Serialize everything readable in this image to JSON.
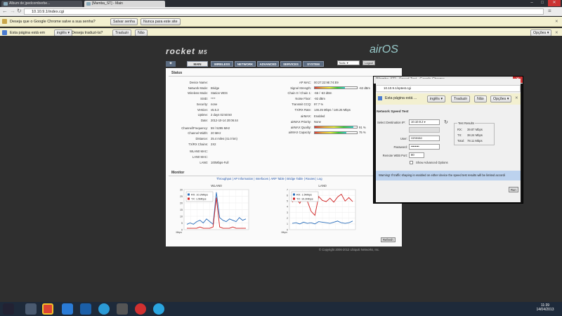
{
  "tabs": [
    {
      "label": "Album de jpedcomberbe..."
    },
    {
      "label": "[Mamba_ST] - Main"
    }
  ],
  "window_controls": {
    "min": "–",
    "max": "□",
    "close": "✕"
  },
  "address": {
    "url": "10.10.9.1/index.cgi"
  },
  "password_bar": {
    "text": "Deseja que o Google Chrome salve a sua senha?",
    "save": "Salvar senha",
    "never": "Nunca para este site"
  },
  "translate_bar": {
    "text1": "Esta página está em",
    "language": "inglês",
    "text2": "Deseja traduzi-la?",
    "translate": "Traduzir",
    "no": "Não",
    "options": "Opções"
  },
  "brand": {
    "product": "rocket",
    "model": "M5",
    "os": "airOS",
    "tools": "Tools:",
    "logout": "Logout"
  },
  "nav": [
    "MAIN",
    "WIRELESS",
    "NETWORK",
    "ADVANCED",
    "SERVICES",
    "SYSTEM"
  ],
  "status": {
    "title": "Status",
    "left": [
      {
        "label": "Device Name:",
        "value": ""
      },
      {
        "label": "Network Mode:",
        "value": "Bridge"
      },
      {
        "label": "Wireless Mode:",
        "value": "Station WDS"
      },
      {
        "label": "SSID:",
        "value": "****"
      },
      {
        "label": "Security:",
        "value": "none"
      },
      {
        "label": "Version:",
        "value": "v5.5.3"
      },
      {
        "label": "Uptime:",
        "value": "2 days 02:50:50"
      },
      {
        "label": "Date:",
        "value": "2012-10-14 20:06:44"
      },
      {
        "label": "Channel/Frequency:",
        "value": "59 / 5295 MHz"
      },
      {
        "label": "Channel Width:",
        "value": "20 MHz"
      },
      {
        "label": "Distance:",
        "value": "25.4 miles (41.0 km)"
      },
      {
        "label": "TX/RX Chains:",
        "value": "2X2"
      },
      {
        "label": "WLAN0 MAC:",
        "value": ""
      },
      {
        "label": "LAN0 MAC:",
        "value": ""
      },
      {
        "label": "LAN0:",
        "value": "100Mbps-Full"
      }
    ],
    "right": [
      {
        "label": "AP MAC:",
        "value": "00:27:22:9E:74:E9"
      },
      {
        "label": "Signal Strength:",
        "value": "-62 dBm",
        "bar": 0.72
      },
      {
        "label": "Chain 0 / Chain 1:",
        "value": "-66 / -63 dBm"
      },
      {
        "label": "Noise Floor:",
        "value": "-92 dBm"
      },
      {
        "label": "Transmit CCQ:",
        "value": "97.7 %"
      },
      {
        "label": "TX/RX Rate:",
        "value": "146.25 Mbps / 146.25 Mbps"
      },
      {
        "label": "airMAX:",
        "value": "Enabled"
      },
      {
        "label": "airMAX Priority:",
        "value": "None"
      },
      {
        "label": "airMAX Quality:",
        "value": "91 %",
        "bar": 0.91
      },
      {
        "label": "airMAX Capacity:",
        "value": "75 %",
        "bar": 0.75
      }
    ]
  },
  "monitor": {
    "title": "Monitor",
    "links": "Throughput | AP Information | Interfaces | ARP Table | Bridge Table | Routes | Log",
    "refresh": "Refresh",
    "charts": [
      {
        "title": "WLAN0",
        "unit": "Mbps",
        "yticks": [
          "30",
          "25",
          "20",
          "15",
          "10",
          "5",
          "0"
        ],
        "rx_label": "RX: 10.2Mbps",
        "tx_label": "TX: 1.5Mbps",
        "rx": [
          4,
          5,
          4,
          6,
          7,
          5,
          8,
          6,
          4,
          28,
          9,
          7,
          6,
          8,
          7,
          6,
          9,
          7,
          8
        ],
        "tx": [
          1,
          1,
          1,
          1,
          2,
          1,
          1,
          1,
          2,
          24,
          2,
          1,
          1,
          1,
          2,
          1,
          1,
          1,
          1
        ],
        "ymax": 30
      },
      {
        "title": "LAN0",
        "unit": "Mbps",
        "yticks": [
          "7",
          "6",
          "5",
          "4",
          "3",
          "2",
          "1",
          "0"
        ],
        "rx_label": "RX: 1.5Mbps",
        "tx_label": "TX: 10.2Mbps",
        "rx": [
          1.1,
          1.2,
          1.0,
          1.3,
          1.1,
          1.2,
          1.0,
          1.4,
          1.3,
          1.2,
          1.1,
          1.3,
          1.5,
          1.2,
          1.1,
          1.2,
          1.5
        ],
        "tx": [
          4.8,
          5.5,
          4.6,
          5.9,
          5.0,
          3.2,
          2.5,
          5.8,
          5.1,
          4.9,
          5.5,
          4.8,
          5.7,
          6.2,
          5.0,
          5.6,
          4.9
        ],
        "ymax": 7
      }
    ]
  },
  "footer": "© Copyright 2006-2012 Ubiquiti Networks, Inc.",
  "popup": {
    "title": "[Mamba_ST] - Speed Test - Google Chrome",
    "url": "10.10.9.1/sptest.cgi",
    "translate_text": "Esta página está ...",
    "language": "inglês",
    "translate": "Traduzir",
    "no": "Não",
    "options": "Opções",
    "heading": "Network Speed Test",
    "dest_label": "Select Destination IP:",
    "dest_value": "10.10.9.2",
    "user_label": "User:",
    "user_value": "conexao",
    "pass_label": "Password:",
    "pass_value": "••••••••",
    "port_label": "Remote WEB Port:",
    "port_value": "80",
    "advanced": "Show Advanced Options",
    "results_title": "Test Results",
    "results": [
      {
        "k": "RX:",
        "v": "39.87 Mbps"
      },
      {
        "k": "TX:",
        "v": "38.24 Mbps"
      },
      {
        "k": "Total:",
        "v": "78.11 Mbps"
      }
    ],
    "warning": "Warning! If traffic shaping is enabled on either device the speed test results will be limited accordi",
    "run": "Run"
  },
  "clock": {
    "time": "11:39",
    "date": "14/04/2013"
  },
  "colors": {
    "rx": "#2a6ebb",
    "tx": "#d02020"
  }
}
